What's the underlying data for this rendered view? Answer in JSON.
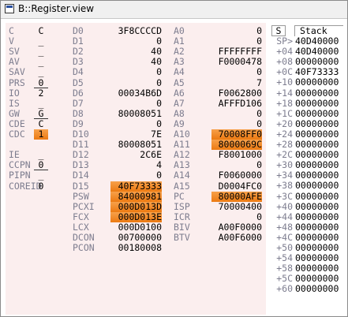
{
  "window": {
    "title": "B::Register.view"
  },
  "flags": [
    {
      "label": "C",
      "value": "C",
      "style": "plain"
    },
    {
      "label": "V",
      "value": "_",
      "style": "plain"
    },
    {
      "label": "SV",
      "value": "_",
      "style": "plain"
    },
    {
      "label": "AV",
      "value": "_",
      "style": "plain"
    },
    {
      "label": "SAV",
      "value": "_",
      "style": "plain"
    },
    {
      "label": "PRS",
      "value": "0",
      "style": "under"
    },
    {
      "label": "IO",
      "value": "2",
      "style": "plain"
    },
    {
      "label": "IS",
      "value": "_",
      "style": "plain"
    },
    {
      "label": "GW",
      "value": "G",
      "style": "under"
    },
    {
      "label": "CDE",
      "value": "C",
      "style": "plain"
    },
    {
      "label": "CDC",
      "value": "1",
      "style": "hl"
    },
    {
      "label": "",
      "value": "",
      "style": "plain"
    },
    {
      "label": "IE",
      "value": "_",
      "style": "plain"
    },
    {
      "label": "CCPN",
      "value": "0",
      "style": "under"
    },
    {
      "label": "PIPN",
      "value": "_",
      "style": "plain"
    },
    {
      "label": "COREID",
      "value": "0",
      "style": "plain"
    }
  ],
  "dregs": [
    {
      "label": "D0",
      "value": "3F8CCCCD",
      "hl": false
    },
    {
      "label": "D1",
      "value": "0",
      "hl": false
    },
    {
      "label": "D2",
      "value": "40",
      "hl": false
    },
    {
      "label": "D3",
      "value": "40",
      "hl": false
    },
    {
      "label": "D4",
      "value": "0",
      "hl": false
    },
    {
      "label": "D5",
      "value": "0",
      "hl": false
    },
    {
      "label": "D6",
      "value": "00034B6D",
      "hl": false
    },
    {
      "label": "D7",
      "value": "0",
      "hl": false
    },
    {
      "label": "D8",
      "value": "80008051",
      "hl": false
    },
    {
      "label": "D9",
      "value": "0",
      "hl": false
    },
    {
      "label": "D10",
      "value": "7E",
      "hl": false
    },
    {
      "label": "D11",
      "value": "80008051",
      "hl": false
    },
    {
      "label": "D12",
      "value": "2C6E",
      "hl": false
    },
    {
      "label": "D13",
      "value": "4",
      "hl": false
    },
    {
      "label": "D14",
      "value": "0",
      "hl": false
    },
    {
      "label": "D15",
      "value": "40F73333",
      "hl": true
    },
    {
      "label": "PSW",
      "value": "84000981",
      "hl": true
    },
    {
      "label": "PCXI",
      "value": "000D013D",
      "hl": true
    },
    {
      "label": "FCX",
      "value": "000D013E",
      "hl": true
    },
    {
      "label": "LCX",
      "value": "000D0100",
      "hl": false
    },
    {
      "label": "DCON",
      "value": "00700000",
      "hl": false
    },
    {
      "label": "PCON",
      "value": "00180008",
      "hl": false
    }
  ],
  "aregs": [
    {
      "label": "A0",
      "value": "0",
      "hl": false
    },
    {
      "label": "A1",
      "value": "0",
      "hl": false
    },
    {
      "label": "A2",
      "value": "FFFFFFFF",
      "hl": false
    },
    {
      "label": "A3",
      "value": "F0000478",
      "hl": false
    },
    {
      "label": "A4",
      "value": "0",
      "hl": false
    },
    {
      "label": "A5",
      "value": "7",
      "hl": false
    },
    {
      "label": "A6",
      "value": "F0062800",
      "hl": false
    },
    {
      "label": "A7",
      "value": "AFFFD106",
      "hl": false
    },
    {
      "label": "A8",
      "value": "0",
      "hl": false
    },
    {
      "label": "A9",
      "value": "0",
      "hl": false
    },
    {
      "label": "A10",
      "value": "70008FF0",
      "hl": true
    },
    {
      "label": "A11",
      "value": "8000069C",
      "hl": true
    },
    {
      "label": "A12",
      "value": "F8001000",
      "hl": false
    },
    {
      "label": "A13",
      "value": "0",
      "hl": false
    },
    {
      "label": "A14",
      "value": "F0060000",
      "hl": false
    },
    {
      "label": "A15",
      "value": "D0004FC0",
      "hl": false
    },
    {
      "label": "PC",
      "value": "80000AFE",
      "hl": true
    },
    {
      "label": "ISP",
      "value": "70000400",
      "hl": false
    },
    {
      "label": "ICR",
      "value": "0",
      "hl": false
    },
    {
      "label": "BIV",
      "value": "A00F0000",
      "hl": false
    },
    {
      "label": "BTV",
      "value": "A00F6000",
      "hl": false
    }
  ],
  "stack": {
    "header_s": "S",
    "header_title": "Stack",
    "rows": [
      {
        "off": "SP>",
        "value": "40D40000"
      },
      {
        "off": "+04",
        "value": "40D40000"
      },
      {
        "off": "+08",
        "value": "00000000"
      },
      {
        "off": "+0C",
        "value": "40F73333"
      },
      {
        "off": "+10",
        "value": "00000000"
      },
      {
        "off": "+14",
        "value": "00000000"
      },
      {
        "off": "+18",
        "value": "00000000"
      },
      {
        "off": "+1C",
        "value": "00000000"
      },
      {
        "off": "+20",
        "value": "00000000"
      },
      {
        "off": "+24",
        "value": "00000000"
      },
      {
        "off": "+28",
        "value": "00000000"
      },
      {
        "off": "+2C",
        "value": "00000000"
      },
      {
        "off": "+30",
        "value": "00000000"
      },
      {
        "off": "+34",
        "value": "00000000"
      },
      {
        "off": "+38",
        "value": "00000000"
      },
      {
        "off": "+3C",
        "value": "00000000"
      },
      {
        "off": "+40",
        "value": "00000000"
      },
      {
        "off": "+44",
        "value": "00000000"
      },
      {
        "off": "+48",
        "value": "00000000"
      },
      {
        "off": "+4C",
        "value": "00000000"
      },
      {
        "off": "+50",
        "value": "00000000"
      },
      {
        "off": "+54",
        "value": "00000000"
      },
      {
        "off": "+58",
        "value": "00000000"
      },
      {
        "off": "+5C",
        "value": "00000000"
      },
      {
        "off": "+60",
        "value": "00000000"
      }
    ]
  },
  "colors": {
    "highlight": "#f28c28",
    "panel_bg": "#fbeeee",
    "label": "#7d7d8f"
  }
}
